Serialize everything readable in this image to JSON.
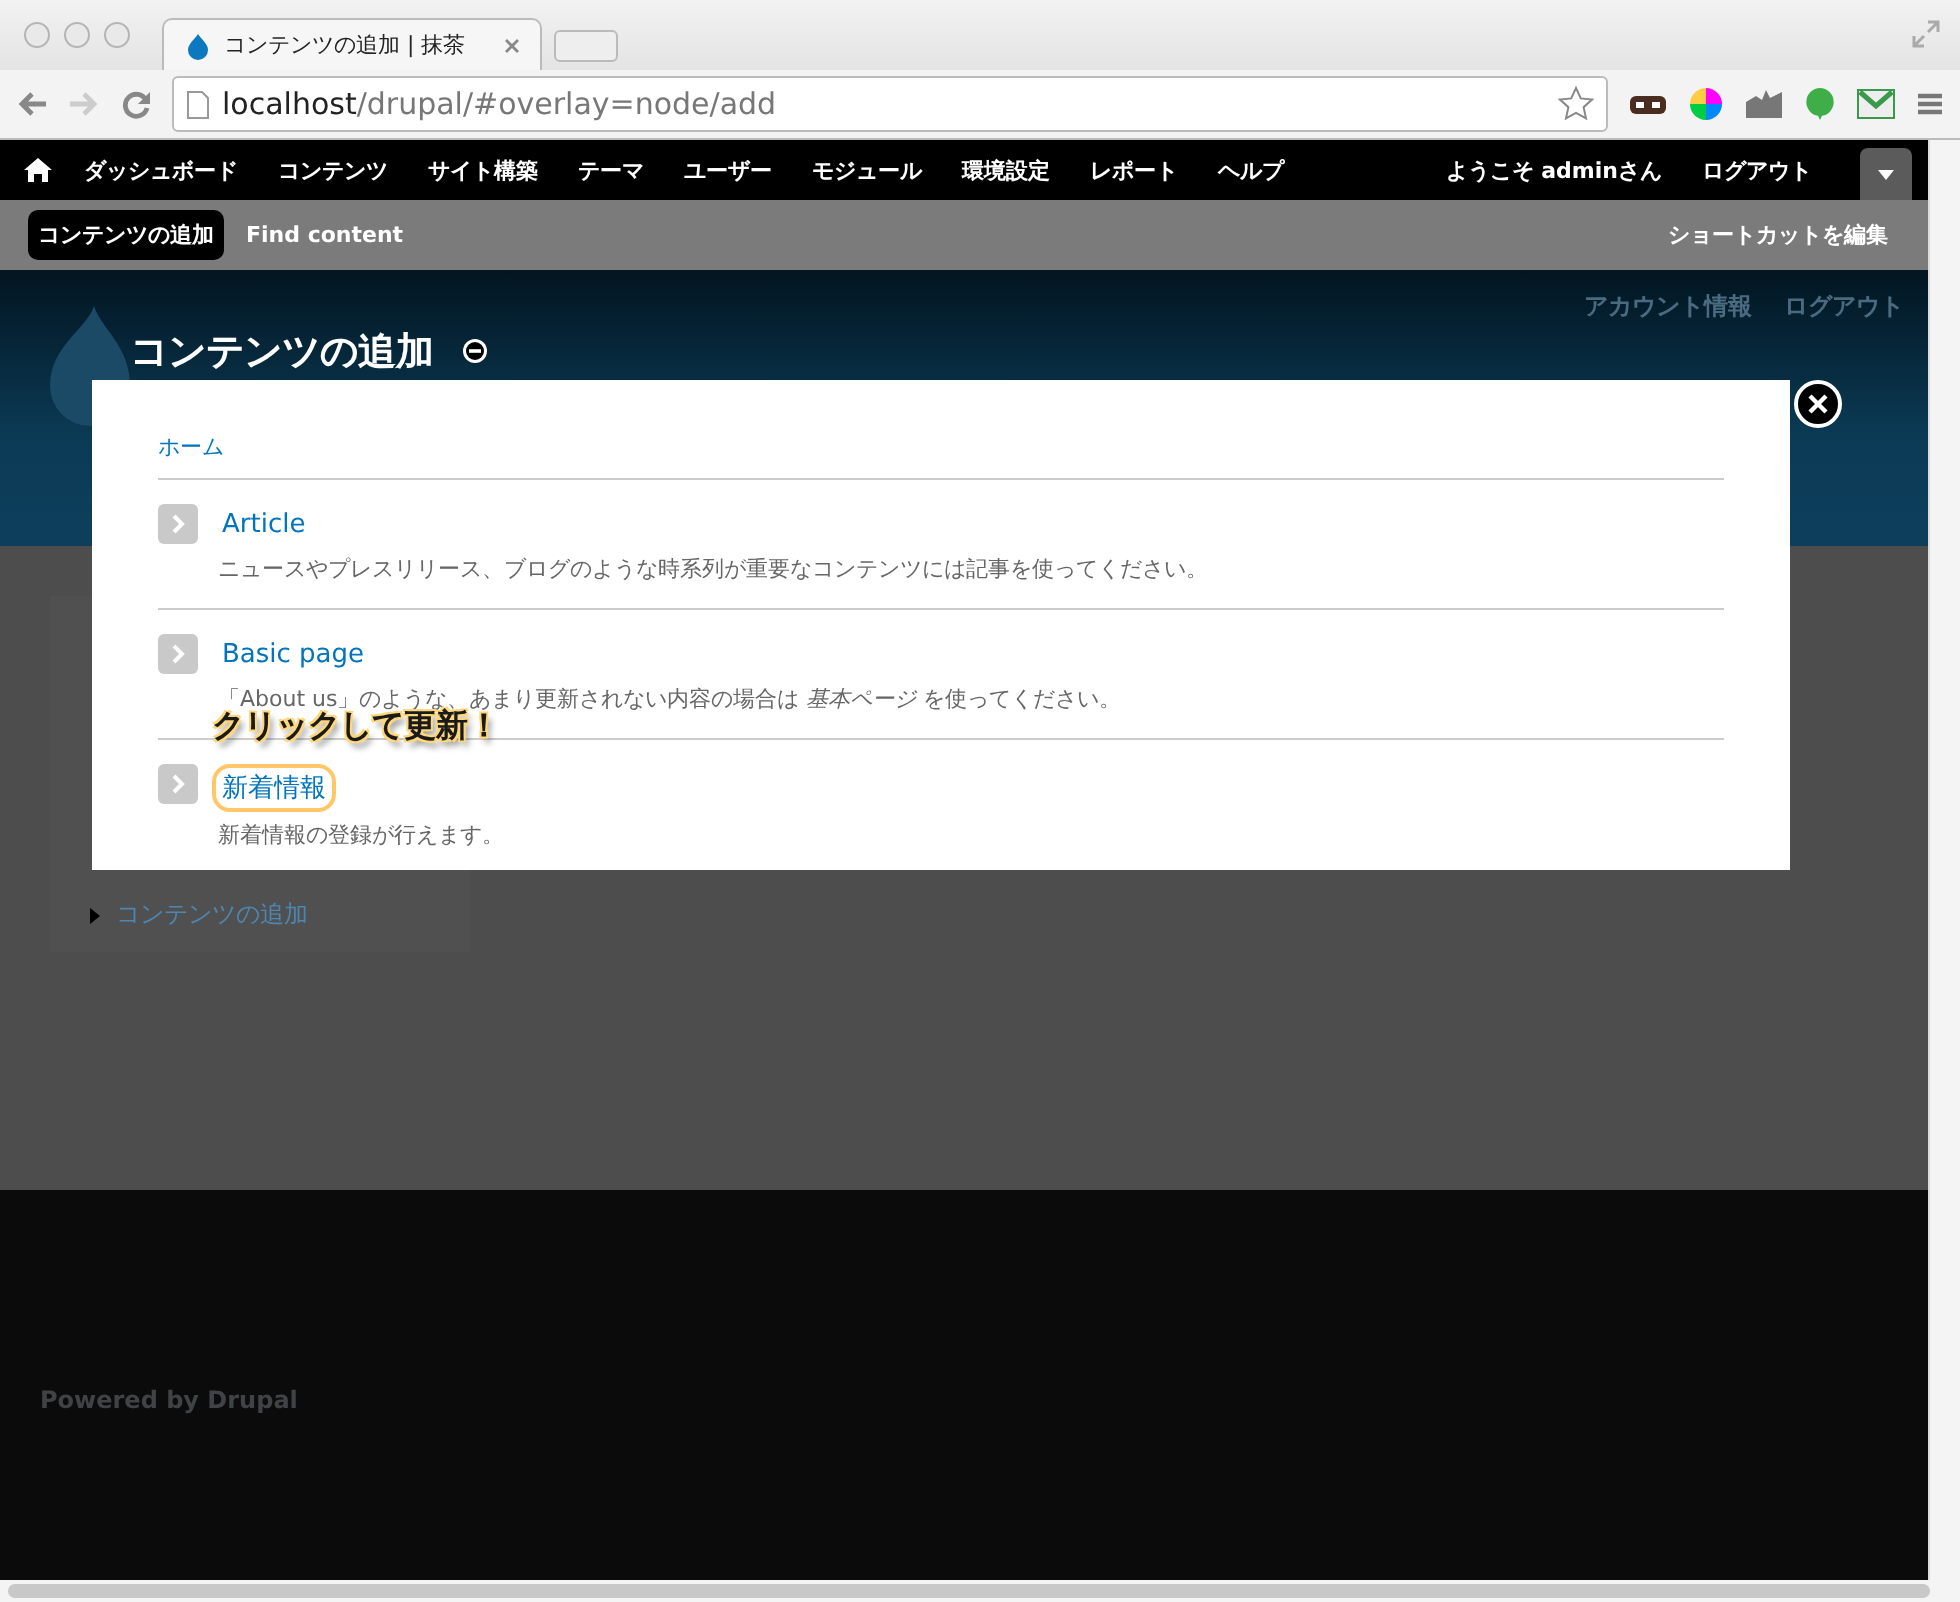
{
  "browser": {
    "tab_title": "コンテンツの追加 | 抹茶",
    "url_host": "localhost",
    "url_path": "/drupal/#overlay=node/add"
  },
  "toolbar": {
    "menu": [
      "ダッシュボード",
      "コンテンツ",
      "サイト構築",
      "テーマ",
      "ユーザー",
      "モジュール",
      "環境設定",
      "レポート",
      "ヘルプ"
    ],
    "user": "ようこそ adminさん",
    "logout": "ログアウト"
  },
  "shortcuts": {
    "items": [
      {
        "label": "コンテンツの追加",
        "selected": true
      },
      {
        "label": "Find content",
        "selected": false
      }
    ],
    "edit": "ショートカットを編集"
  },
  "header": {
    "secondary_menu": [
      "アカウント情報",
      "ログアウト"
    ]
  },
  "sidebar": {
    "links": [
      "コンテンツの追加"
    ]
  },
  "overlay": {
    "title": "コンテンツの追加",
    "breadcrumb": "ホーム",
    "items": [
      {
        "name": "Article",
        "description": "ニュースやプレスリリース、ブログのような時系列が重要なコンテンツには記事を使ってください。",
        "highlighted": false
      },
      {
        "name": "Basic page",
        "description": "「About us」のような、あまり更新されない内容の場合は *基本ページ* を使ってください。",
        "highlighted": false
      },
      {
        "name": "新着情報",
        "description": "新着情報の登録が行えます。",
        "highlighted": true
      }
    ]
  },
  "annotation": "クリックして更新！",
  "footer": "Powered by Drupal"
}
